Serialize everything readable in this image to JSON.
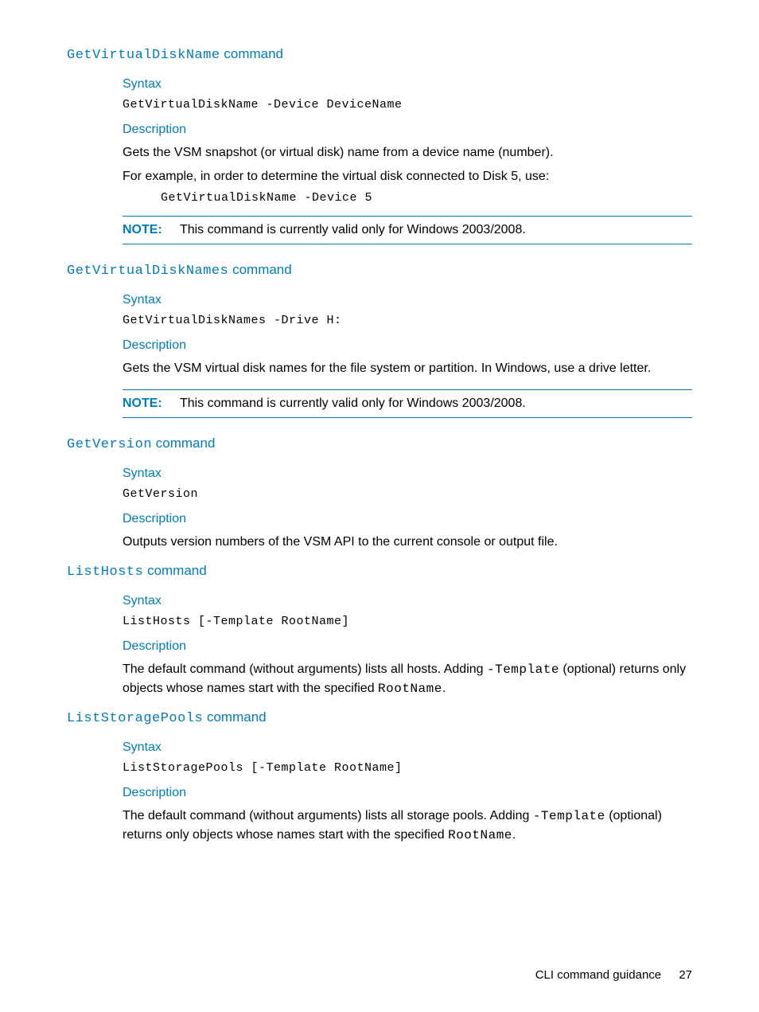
{
  "sections": [
    {
      "cmd": "GetVirtualDiskName",
      "heading_word": "command",
      "syntax_label": "Syntax",
      "syntax_code": "GetVirtualDiskName -Device DeviceName",
      "desc_label": "Description",
      "desc_paras": [
        "Gets the VSM snapshot (or virtual disk) name from a device name (number).",
        "For example, in order to determine the virtual disk connected to Disk 5, use:"
      ],
      "example_code": "GetVirtualDiskName -Device 5",
      "note_label": "NOTE:",
      "note_text": "This command is currently valid only for Windows 2003/2008."
    },
    {
      "cmd": "GetVirtualDiskNames",
      "heading_word": "command",
      "syntax_label": "Syntax",
      "syntax_code": "GetVirtualDiskNames -Drive H:",
      "desc_label": "Description",
      "desc_text": "Gets the VSM virtual disk names for the file system or partition. In Windows, use a drive letter.",
      "note_label": "NOTE:",
      "note_text": "This command is currently valid only for Windows 2003/2008."
    },
    {
      "cmd": "GetVersion",
      "heading_word": "command",
      "syntax_label": "Syntax",
      "syntax_code": "GetVersion",
      "desc_label": "Description",
      "desc_text": "Outputs version numbers of the VSM API to the current console or output file."
    },
    {
      "cmd": "ListHosts",
      "heading_word": "command",
      "syntax_label": "Syntax",
      "syntax_code": "ListHosts [-Template RootName]",
      "desc_label": "Description",
      "desc_pre": "The default command (without arguments) lists all hosts. Adding ",
      "desc_mono1": "-Template",
      "desc_mid": " (optional) returns only objects whose names start with the specified ",
      "desc_mono2": "RootName",
      "desc_post": "."
    },
    {
      "cmd": "ListStoragePools",
      "heading_word": "command",
      "syntax_label": "Syntax",
      "syntax_code": "ListStoragePools [-Template RootName]",
      "desc_label": "Description",
      "desc_pre": "The default command (without arguments) lists all storage pools. Adding ",
      "desc_mono1": "-Template",
      "desc_mid": " (optional) returns only objects whose names start with the specified ",
      "desc_mono2": "RootName",
      "desc_post": "."
    }
  ],
  "footer": {
    "text": "CLI command guidance",
    "page": "27"
  }
}
